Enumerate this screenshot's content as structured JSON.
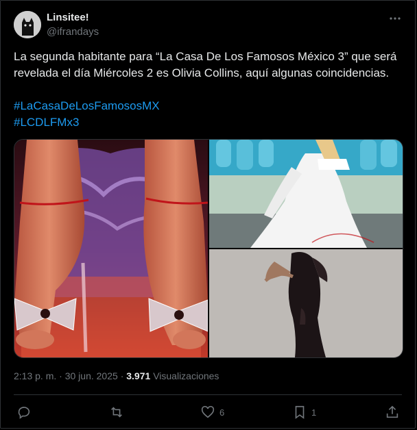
{
  "user": {
    "display_name": "Linsitee!",
    "handle": "@ifrandays"
  },
  "tweet": {
    "text": "La segunda habitante para “La Casa De Los Famosos México 3” que será revelada el día Miércoles 2 es Olivia Collins, aquí algunas coincidencias.",
    "hashtags": [
      "#LaCasaDeLosFamososMX",
      "#LCDLFMx3"
    ]
  },
  "media": {
    "images": [
      {
        "subject": "red-heels-closeup"
      },
      {
        "subject": "white-gown-photo"
      },
      {
        "subject": "black-dress-photo"
      }
    ]
  },
  "meta": {
    "time": "2:13 p. m.",
    "separator": "·",
    "date": "30 jun. 2025",
    "views_count": "3.971",
    "views_label": "Visualizaciones"
  },
  "actions": {
    "reply_count": "",
    "retweet_count": "",
    "like_count": "6",
    "bookmark_count": "1"
  },
  "colors": {
    "background": "#000000",
    "text": "#e7e9ea",
    "muted": "#71767b",
    "link": "#1d9bf0",
    "border": "#2f3336"
  },
  "icons": [
    "more-icon",
    "reply-icon",
    "retweet-icon",
    "like-icon",
    "bookmark-icon",
    "share-icon"
  ]
}
